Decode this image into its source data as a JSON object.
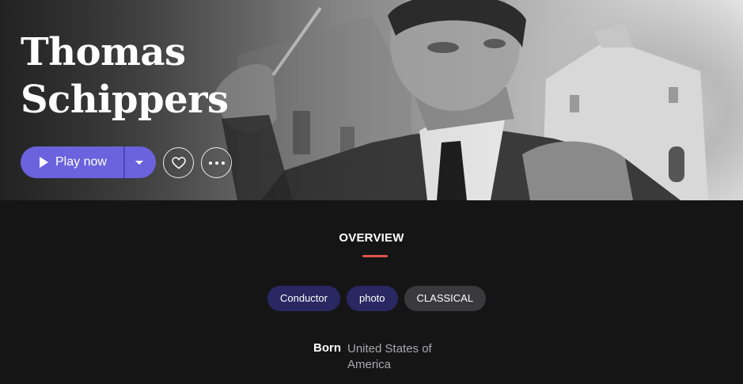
{
  "artist": {
    "name": "Thomas Schippers"
  },
  "actions": {
    "play_label": "Play now"
  },
  "tabs": {
    "overview_label": "OVERVIEW"
  },
  "tags": [
    "Conductor",
    "photo",
    "CLASSICAL"
  ],
  "details": {
    "born_label": "Born",
    "born_value": "United States of America"
  },
  "colors": {
    "accent": "#6a63dd",
    "tab_indicator": "#e0544d",
    "tag_purple": "#2a2862",
    "tag_gray": "#3a393b",
    "background": "#161516"
  },
  "icons": [
    "play-icon",
    "dropdown-caret-icon",
    "heart-icon",
    "more-dots-icon"
  ]
}
